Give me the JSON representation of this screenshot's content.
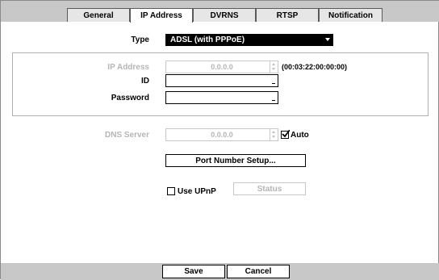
{
  "tabs": [
    "General",
    "IP Address",
    "DVRNS",
    "RTSP",
    "Notification"
  ],
  "type": {
    "label": "Type",
    "value": "ADSL (with PPPoE)"
  },
  "ip_address": {
    "label": "IP Address",
    "value": "0.0.0.0",
    "mac": "(00:03:22:00:00:00)"
  },
  "id": {
    "label": "ID",
    "value": ""
  },
  "password": {
    "label": "Password",
    "value": ""
  },
  "dns_server": {
    "label": "DNS Server",
    "value": "0.0.0.0",
    "auto_label": "Auto",
    "auto_checked": true
  },
  "port_setup_label": "Port Number Setup...",
  "upnp": {
    "label": "Use UPnP",
    "checked": false,
    "status_label": "Status"
  },
  "footer": {
    "save_label": "Save",
    "cancel_label": "Cancel"
  }
}
